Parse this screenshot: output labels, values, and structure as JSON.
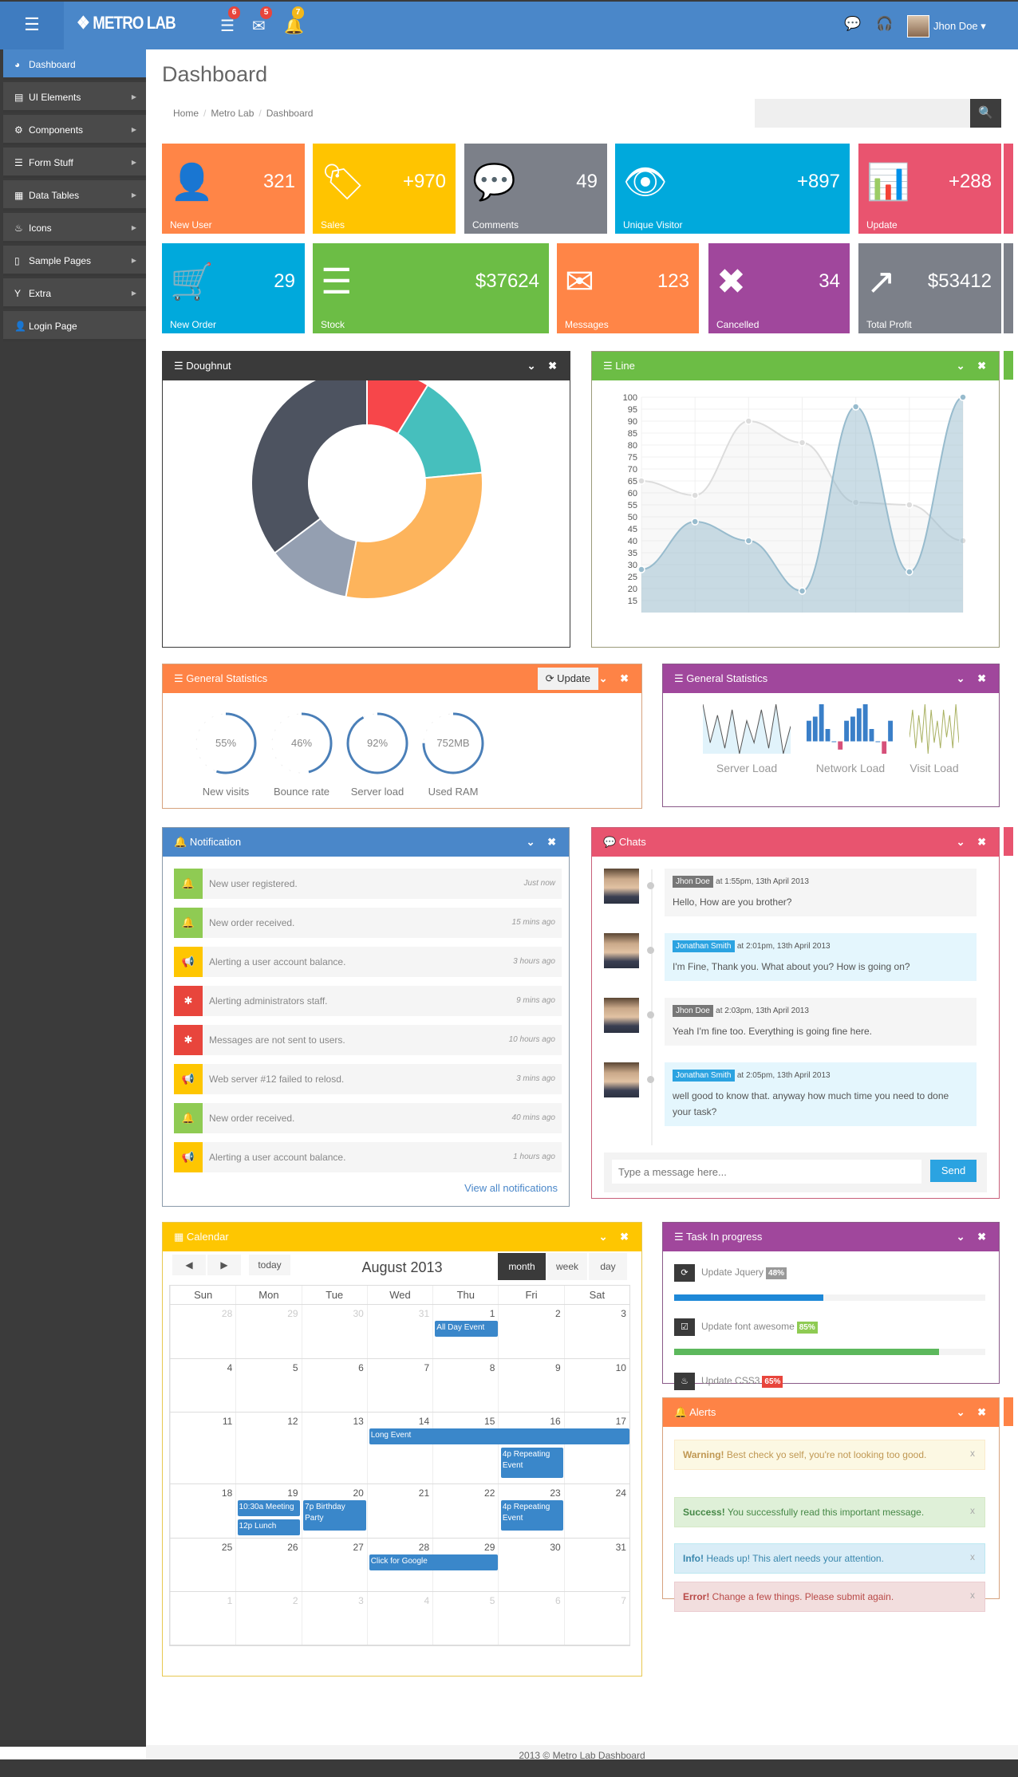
{
  "header": {
    "logo": "METRO LAB",
    "menu_icon": "hamburger-icon",
    "icons": [
      {
        "icon": "tasks-icon",
        "glyph": "☰",
        "badge": "6",
        "badge_color": "#e8453c"
      },
      {
        "icon": "envelope-icon",
        "glyph": "✉",
        "badge": "5",
        "badge_color": "#e8453c"
      },
      {
        "icon": "bell-icon",
        "glyph": "🔔",
        "badge": "7",
        "badge_color": "#f3b81a"
      }
    ],
    "right_icons": [
      {
        "icon": "chat-icon",
        "glyph": "💬"
      },
      {
        "icon": "headphones-icon",
        "glyph": "🎧"
      }
    ],
    "user": "Jhon Doe ▾",
    "color": "#4a87c9"
  },
  "sidebar": {
    "items": [
      {
        "label": "Dashboard",
        "icon": "dashboard-icon",
        "glyph": "◕",
        "active": true
      },
      {
        "label": "UI Elements",
        "icon": "book-icon",
        "glyph": "▤",
        "sub": true
      },
      {
        "label": "Components",
        "icon": "cogs-icon",
        "glyph": "⚙",
        "sub": true
      },
      {
        "label": "Form Stuff",
        "icon": "form-icon",
        "glyph": "☰",
        "sub": true
      },
      {
        "label": "Data Tables",
        "icon": "table-icon",
        "glyph": "▦",
        "sub": true
      },
      {
        "label": "Icons",
        "icon": "fire-icon",
        "glyph": "♨",
        "sub": true
      },
      {
        "label": "Sample Pages",
        "icon": "file-icon",
        "glyph": "▯",
        "sub": true
      },
      {
        "label": "Extra",
        "icon": "filter-icon",
        "glyph": "Y",
        "sub": true
      },
      {
        "label": "Login Page",
        "icon": "user-icon",
        "glyph": "👤"
      }
    ],
    "arrow": "▶"
  },
  "page": {
    "title": "Dashboard",
    "breadcrumb": [
      "Home",
      "Metro Lab",
      "Dashboard"
    ],
    "search_placeholder": "",
    "search_icon": "🔍"
  },
  "tiles": [
    {
      "label": "New User",
      "value": "321",
      "icon": "user-icon",
      "glyph": "👤",
      "color": "#ff8547"
    },
    {
      "label": "Sales",
      "value": "+970",
      "icon": "tags-icon",
      "glyph": "🏷",
      "color": "#ffc400"
    },
    {
      "label": "Comments",
      "value": "49",
      "icon": "comments-icon",
      "glyph": "💬",
      "color": "#7c8089"
    },
    {
      "label": "Unique Visitor",
      "value": "+897",
      "icon": "eye-icon",
      "glyph": "👁",
      "color": "#00a9dc"
    },
    {
      "label": "Update",
      "value": "+288",
      "icon": "bar-chart-icon",
      "glyph": "📊",
      "color": "#e9546f"
    },
    {
      "label": "New Order",
      "value": "29",
      "icon": "cart-icon",
      "glyph": "🛒",
      "color": "#00a9dc"
    },
    {
      "label": "Stock",
      "value": "$37624",
      "icon": "stock-icon",
      "glyph": "☰",
      "color": "#6cbd45"
    },
    {
      "label": "Messages",
      "value": "123",
      "icon": "envelope-icon",
      "glyph": "✉",
      "color": "#ff8547"
    },
    {
      "label": "Cancelled",
      "value": "34",
      "icon": "cancel-icon",
      "glyph": "✖",
      "color": "#a0479c"
    },
    {
      "label": "Total Profit",
      "value": "$53412",
      "icon": "share-icon",
      "glyph": "↗",
      "color": "#7c8089"
    }
  ],
  "doughnut": {
    "title": "Doughnut",
    "color": "#3a3a3a"
  },
  "line": {
    "title": "Line",
    "color": "#6cbd45"
  },
  "chart_data": [
    {
      "type": "pie",
      "variant": "doughnut",
      "values": [
        30,
        50,
        100,
        40,
        120
      ],
      "colors": [
        "#f7464a",
        "#46bfbd",
        "#fdb45c",
        "#949fb1",
        "#4d5360"
      ]
    },
    {
      "type": "area",
      "x": [
        1,
        2,
        3,
        4,
        5,
        6,
        7
      ],
      "ylim": [
        10,
        100
      ],
      "yticks": [
        15,
        20,
        25,
        30,
        35,
        40,
        45,
        50,
        55,
        60,
        65,
        70,
        75,
        80,
        85,
        90,
        95,
        100
      ],
      "grid": true,
      "series": [
        {
          "values": [
            65,
            59,
            90,
            81,
            56,
            55,
            40
          ],
          "color": "#dcdcdc"
        },
        {
          "values": [
            28,
            48,
            40,
            19,
            96,
            27,
            100
          ],
          "color": "#97bbcd"
        }
      ]
    }
  ],
  "stats": {
    "title": "General Statistics",
    "update": "Update",
    "color": "#fe8346",
    "knobs": [
      {
        "value": "55%",
        "fraction": 0.55,
        "label": "New visits"
      },
      {
        "value": "46%",
        "fraction": 0.46,
        "label": "Bounce rate"
      },
      {
        "value": "92%",
        "fraction": 0.92,
        "label": "Server load"
      },
      {
        "value": "752MB",
        "fraction": 0.75,
        "label": "Used RAM"
      }
    ]
  },
  "stats2": {
    "title": "General Statistics",
    "color": "#a0479c",
    "sparks": [
      {
        "label": "Server Load",
        "values": [
          10,
          3,
          8,
          2,
          9,
          1,
          7,
          3,
          9,
          2,
          10,
          1,
          6
        ]
      },
      {
        "label": "Network Load",
        "values": [
          5,
          6,
          9,
          3,
          0,
          -2,
          5,
          6,
          8,
          9,
          3,
          0,
          -3,
          5
        ]
      },
      {
        "label": "Visit Load",
        "values": [
          4,
          9,
          2,
          8,
          3,
          10,
          1,
          9,
          3,
          7,
          2,
          9,
          4,
          8,
          2,
          10,
          3
        ]
      }
    ]
  },
  "notifications": {
    "title": "Notification",
    "color": "#4a87c9",
    "view_all": "View all notifications",
    "items": [
      {
        "text": "New user registered.",
        "time": "Just now",
        "color": "#8fcb53",
        "icon": "bell-icon",
        "glyph": "🔔"
      },
      {
        "text": "New order received.",
        "time": "15 mins ago",
        "color": "#8fcb53",
        "icon": "bell-icon",
        "glyph": "🔔"
      },
      {
        "text": "Alerting a user account balance.",
        "time": "3 hours ago",
        "color": "#fec601",
        "icon": "bullhorn-icon",
        "glyph": "📢"
      },
      {
        "text": "Alerting administrators staff.",
        "time": "9 mins ago",
        "color": "#e8453c",
        "icon": "bug-icon",
        "glyph": "✱"
      },
      {
        "text": "Messages are not sent to users.",
        "time": "10 hours ago",
        "color": "#e8453c",
        "icon": "bug-icon",
        "glyph": "✱"
      },
      {
        "text": "Web server #12 failed to relosd.",
        "time": "3 mins ago",
        "color": "#fec601",
        "icon": "bullhorn-icon",
        "glyph": "📢"
      },
      {
        "text": "New order received.",
        "time": "40 mins ago",
        "color": "#8fcb53",
        "icon": "bell-icon",
        "glyph": "🔔"
      },
      {
        "text": "Alerting a user account balance.",
        "time": "1 hours ago",
        "color": "#fec601",
        "icon": "bullhorn-icon",
        "glyph": "📢"
      }
    ]
  },
  "chats": {
    "title": "Chats",
    "color": "#e8546f",
    "placeholder": "Type a message here...",
    "send": "Send",
    "messages": [
      {
        "name": "Jhon Doe",
        "time": "at 1:55pm, 13th April 2013",
        "text": "Hello, How are you brother?",
        "blue": false
      },
      {
        "name": "Jonathan Smith",
        "time": "at 2:01pm, 13th April 2013",
        "text": "I'm Fine, Thank you. What about you? How is going on?",
        "blue": true
      },
      {
        "name": "Jhon Doe",
        "time": "at 2:03pm, 13th April 2013",
        "text": "Yeah I'm fine too. Everything is going fine here.",
        "blue": false
      },
      {
        "name": "Jonathan Smith",
        "time": "at 2:05pm, 13th April 2013",
        "text": "well good to know that. anyway how much time you need to done your task?",
        "blue": true
      }
    ]
  },
  "calendar": {
    "title": "Calendar",
    "color": "#fec601",
    "prev": "◀",
    "next": "▶",
    "today": "today",
    "month_title": "August 2013",
    "views": [
      "month",
      "week",
      "day"
    ],
    "active_view": "month",
    "dow": [
      "Sun",
      "Mon",
      "Tue",
      "Wed",
      "Thu",
      "Fri",
      "Sat"
    ],
    "weeks": [
      {
        "days": [
          28,
          29,
          30,
          31,
          1,
          2,
          3
        ],
        "other": [
          0,
          1,
          2,
          3
        ]
      },
      {
        "days": [
          4,
          5,
          6,
          7,
          8,
          9,
          10
        ],
        "other": []
      },
      {
        "days": [
          11,
          12,
          13,
          14,
          15,
          16,
          17
        ],
        "other": []
      },
      {
        "days": [
          18,
          19,
          20,
          21,
          22,
          23,
          24
        ],
        "other": []
      },
      {
        "days": [
          25,
          26,
          27,
          28,
          29,
          30,
          31
        ],
        "other": []
      },
      {
        "days": [
          1,
          2,
          3,
          4,
          5,
          6,
          7
        ],
        "other": [
          0,
          1,
          2,
          3,
          4,
          5,
          6
        ]
      }
    ],
    "events": [
      {
        "title": "All Day Event",
        "start": 1,
        "days": 1
      },
      {
        "title": "Long Event",
        "start": 14,
        "days": 4
      },
      {
        "title": "4p Repeating Event",
        "start": 16,
        "days": 1
      },
      {
        "title": "10:30a Meeting",
        "start": 19,
        "days": 1
      },
      {
        "title": "12p Lunch",
        "start": 19,
        "days": 1
      },
      {
        "title": "7p Birthday Party",
        "start": 20,
        "days": 1
      },
      {
        "title": "4p Repeating Event",
        "start": 23,
        "days": 1
      },
      {
        "title": "Click for Google",
        "start": 28,
        "days": 2
      }
    ]
  },
  "tasks": {
    "title": "Task In progress",
    "color": "#a0479c",
    "items": [
      {
        "name": "Update Jquery",
        "percent": 48,
        "badge": "48%",
        "badge_color": "#999",
        "bar_color": "#1e88d7",
        "icon": "refresh-icon",
        "glyph": "⟳"
      },
      {
        "name": "Update font awesome",
        "percent": 85,
        "badge": "85%",
        "badge_color": "#8fcb53",
        "bar_color": "#5cb85c",
        "icon": "check-icon",
        "glyph": "☑"
      },
      {
        "name": "Update CSS3",
        "percent": 65,
        "badge": "65%",
        "badge_color": "#e8453c",
        "bar_color": "#e74c3c",
        "icon": "fire-icon",
        "glyph": "♨"
      }
    ]
  },
  "alerts": {
    "title": "Alerts",
    "color": "#fe8346",
    "items": [
      {
        "strong": "Warning!",
        "text": " Best check yo self, you're not looking too good.",
        "type": "warning"
      },
      {
        "strong": "Success!",
        "text": " You successfully read this important message.",
        "type": "success"
      },
      {
        "strong": "Info!",
        "text": " Heads up! This alert needs your attention.",
        "type": "info"
      },
      {
        "strong": "Error!",
        "text": " Change a few things. Please submit again.",
        "type": "error"
      }
    ],
    "close": "x"
  },
  "panel_controls": "⌄ ✖",
  "footer": "2013 © Metro Lab Dashboard"
}
